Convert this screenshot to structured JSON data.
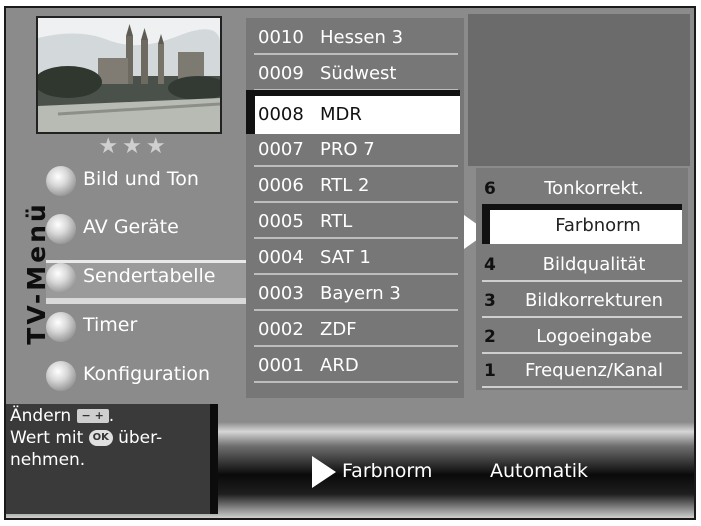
{
  "window": {
    "side_title": "TV-Menü"
  },
  "rating": {
    "stars": "★★★"
  },
  "main_menu": {
    "items": [
      {
        "label": "Bild und Ton"
      },
      {
        "label": "AV Geräte"
      },
      {
        "label": "Sendertabelle",
        "selected": true
      },
      {
        "label": "Timer"
      },
      {
        "label": "Konfiguration"
      }
    ]
  },
  "channels": [
    {
      "num": "0010",
      "name": "Hessen 3"
    },
    {
      "num": "0009",
      "name": "Südwest"
    },
    {
      "num": "0008",
      "name": "MDR",
      "selected": true
    },
    {
      "num": "0007",
      "name": "PRO 7"
    },
    {
      "num": "0006",
      "name": "RTL 2"
    },
    {
      "num": "0005",
      "name": "RTL"
    },
    {
      "num": "0004",
      "name": "SAT 1"
    },
    {
      "num": "0003",
      "name": "Bayern 3"
    },
    {
      "num": "0002",
      "name": "ZDF"
    },
    {
      "num": "0001",
      "name": "ARD"
    }
  ],
  "submenu": [
    {
      "idx": "6",
      "label": "Tonkorrekt."
    },
    {
      "idx": "",
      "label": "Farbnorm",
      "selected": true
    },
    {
      "idx": "4",
      "label": "Bildqualität"
    },
    {
      "idx": "3",
      "label": "Bildkorrekturen"
    },
    {
      "idx": "2",
      "label": "Logoeingabe"
    },
    {
      "idx": "1",
      "label": "Frequenz/Kanal"
    }
  ],
  "help": {
    "line1": "Ändern",
    "line1_key": "− +",
    "line1_end": ".",
    "line2a": "Wert mit",
    "line2_key": "OK",
    "line2b": "über-",
    "line3": "nehmen."
  },
  "status": {
    "label": "Farbnorm",
    "value": "Automatik"
  },
  "colors": {
    "background": "#8b8b8b",
    "selection": "#ffffff",
    "text": "#ffffff"
  }
}
